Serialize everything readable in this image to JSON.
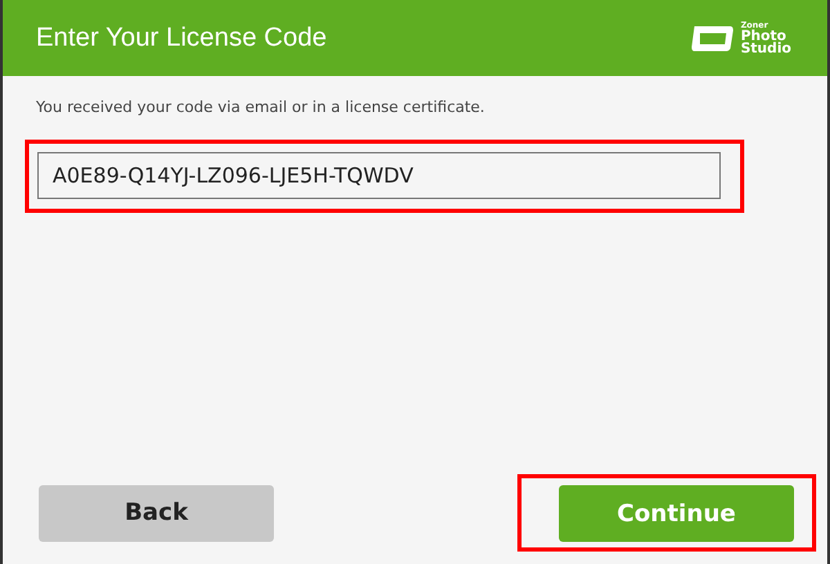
{
  "header": {
    "title": "Enter Your License Code",
    "logo": [
      "Zoner",
      "Photo",
      "Studio"
    ]
  },
  "message": "You received your code via email or in a license certificate.",
  "license_field": {
    "value": "A0E89-Q14YJ-LZ096-LJE5H-TQWDV",
    "highlighted": true
  },
  "buttons": [
    {
      "label": "Back",
      "kind": "secondary",
      "highlighted": false
    },
    {
      "label": "Continue",
      "kind": "primary",
      "highlighted": true
    }
  ]
}
